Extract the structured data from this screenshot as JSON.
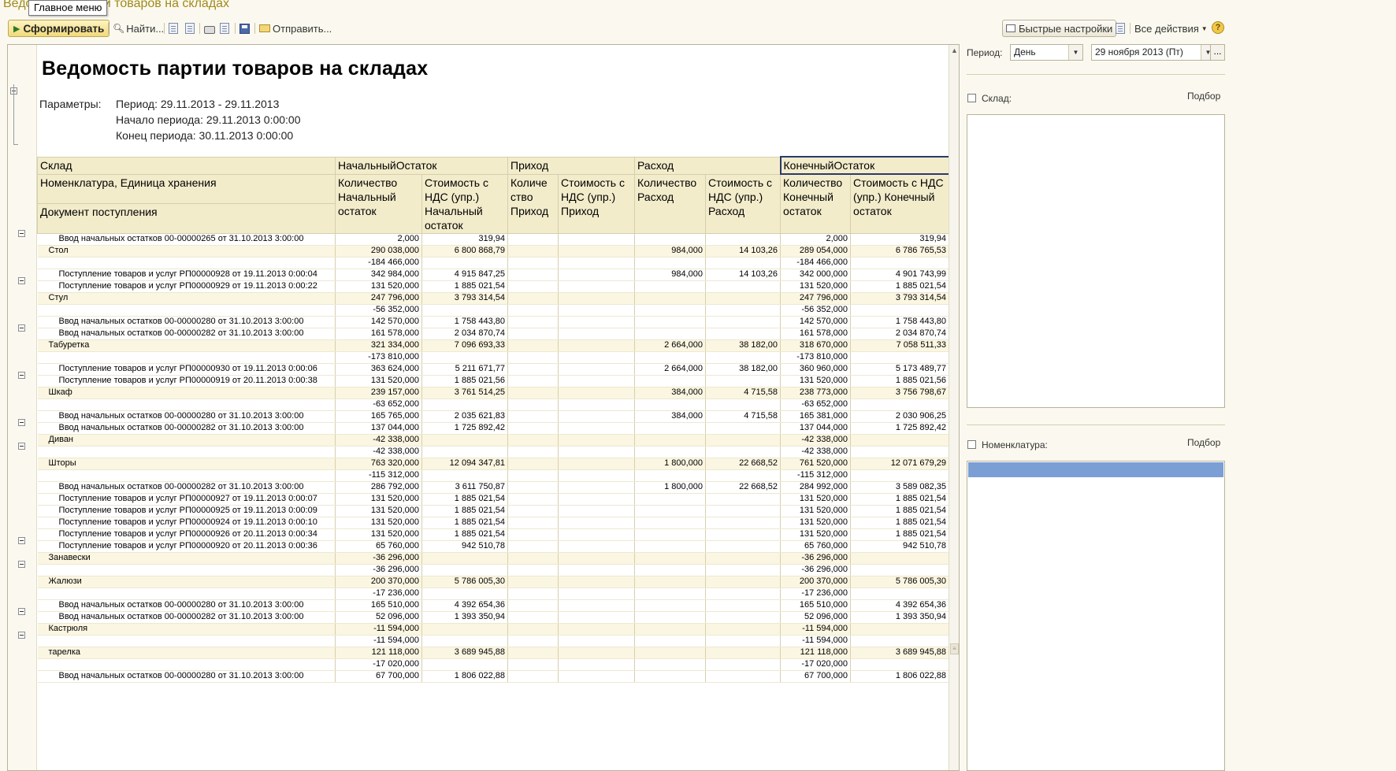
{
  "window": {
    "title": "Ведомость партии товаров на складах",
    "main_menu_tooltip": "Главное меню"
  },
  "toolbar": {
    "generate": "Сформировать",
    "find": "Найти...",
    "send": "Отправить...",
    "quick_settings": "Быстрые настройки",
    "all_actions": "Все действия",
    "help": "?"
  },
  "report": {
    "title": "Ведомость партии товаров на складах",
    "params_label": "Параметры:",
    "params": [
      "Период: 29.11.2013 - 29.11.2013",
      "Начало периода: 29.11.2013 0:00:00",
      "Конец периода: 30.11.2013 0:00:00"
    ],
    "header": {
      "warehouse": "Склад",
      "nomenclature": "Номенклатура, Единица хранения",
      "document": "Документ поступления",
      "start_balance": "НачальныйОстаток",
      "income": "Приход",
      "expense": "Расход",
      "end_balance": "КонечныйОстаток",
      "qty_start": "Количество Начальный остаток",
      "cost_start": "Стоимость с НДС (упр.) Начальный остаток",
      "qty_income": "Количе ство Приход",
      "cost_income": "Стоимость с НДС (упр.) Приход",
      "qty_expense": "Количество Расход",
      "cost_expense": "Стоимость с НДС (упр.) Расход",
      "qty_end": "Количество Конечный остаток",
      "cost_end": "Стоимость с НДС (упр.) Конечный остаток"
    },
    "rows": [
      {
        "t": "d",
        "name": "Ввод начальных остатков 00-00000265 от 31.10.2013 3:00:00",
        "c": [
          "2,000",
          "319,94",
          "",
          "",
          "",
          "",
          "2,000",
          "319,94"
        ]
      },
      {
        "t": "g",
        "name": "Стол",
        "c": [
          "290 038,000",
          "6 800 868,79",
          "",
          "",
          "984,000",
          "14 103,26",
          "289 054,000",
          "6 786 765,53"
        ]
      },
      {
        "t": "d",
        "name": "",
        "c": [
          "-184 466,000",
          "",
          "",
          "",
          "",
          "",
          "-184 466,000",
          ""
        ]
      },
      {
        "t": "d",
        "name": "Поступление товаров и услуг РП00000928 от 19.11.2013 0:00:04",
        "c": [
          "342 984,000",
          "4 915 847,25",
          "",
          "",
          "984,000",
          "14 103,26",
          "342 000,000",
          "4 901 743,99"
        ]
      },
      {
        "t": "d",
        "name": "Поступление товаров и услуг РП00000929 от 19.11.2013 0:00:22",
        "c": [
          "131 520,000",
          "1 885 021,54",
          "",
          "",
          "",
          "",
          "131 520,000",
          "1 885 021,54"
        ]
      },
      {
        "t": "g",
        "name": "Стул",
        "c": [
          "247 796,000",
          "3 793 314,54",
          "",
          "",
          "",
          "",
          "247 796,000",
          "3 793 314,54"
        ]
      },
      {
        "t": "d",
        "name": "",
        "c": [
          "-56 352,000",
          "",
          "",
          "",
          "",
          "",
          "-56 352,000",
          ""
        ]
      },
      {
        "t": "d",
        "name": "Ввод начальных остатков 00-00000280 от 31.10.2013 3:00:00",
        "c": [
          "142 570,000",
          "1 758 443,80",
          "",
          "",
          "",
          "",
          "142 570,000",
          "1 758 443,80"
        ]
      },
      {
        "t": "d",
        "name": "Ввод начальных остатков 00-00000282 от 31.10.2013 3:00:00",
        "c": [
          "161 578,000",
          "2 034 870,74",
          "",
          "",
          "",
          "",
          "161 578,000",
          "2 034 870,74"
        ]
      },
      {
        "t": "g",
        "name": "Табуретка",
        "c": [
          "321 334,000",
          "7 096 693,33",
          "",
          "",
          "2 664,000",
          "38 182,00",
          "318 670,000",
          "7 058 511,33"
        ]
      },
      {
        "t": "d",
        "name": "",
        "c": [
          "-173 810,000",
          "",
          "",
          "",
          "",
          "",
          "-173 810,000",
          ""
        ]
      },
      {
        "t": "d",
        "name": "Поступление товаров и услуг РП00000930 от 19.11.2013 0:00:06",
        "c": [
          "363 624,000",
          "5 211 671,77",
          "",
          "",
          "2 664,000",
          "38 182,00",
          "360 960,000",
          "5 173 489,77"
        ]
      },
      {
        "t": "d",
        "name": "Поступление товаров и услуг РП00000919 от 20.11.2013 0:00:38",
        "c": [
          "131 520,000",
          "1 885 021,56",
          "",
          "",
          "",
          "",
          "131 520,000",
          "1 885 021,56"
        ]
      },
      {
        "t": "g",
        "name": "Шкаф",
        "c": [
          "239 157,000",
          "3 761 514,25",
          "",
          "",
          "384,000",
          "4 715,58",
          "238 773,000",
          "3 756 798,67"
        ]
      },
      {
        "t": "d",
        "name": "",
        "c": [
          "-63 652,000",
          "",
          "",
          "",
          "",
          "",
          "-63 652,000",
          ""
        ]
      },
      {
        "t": "d",
        "name": "Ввод начальных остатков 00-00000280 от 31.10.2013 3:00:00",
        "c": [
          "165 765,000",
          "2 035 621,83",
          "",
          "",
          "384,000",
          "4 715,58",
          "165 381,000",
          "2 030 906,25"
        ]
      },
      {
        "t": "d",
        "name": "Ввод начальных остатков 00-00000282 от 31.10.2013 3:00:00",
        "c": [
          "137 044,000",
          "1 725 892,42",
          "",
          "",
          "",
          "",
          "137 044,000",
          "1 725 892,42"
        ]
      },
      {
        "t": "g",
        "name": "Диван",
        "c": [
          "-42 338,000",
          "",
          "",
          "",
          "",
          "",
          "-42 338,000",
          ""
        ]
      },
      {
        "t": "d",
        "name": "",
        "c": [
          "-42 338,000",
          "",
          "",
          "",
          "",
          "",
          "-42 338,000",
          ""
        ]
      },
      {
        "t": "g",
        "name": "Шторы",
        "c": [
          "763 320,000",
          "12 094 347,81",
          "",
          "",
          "1 800,000",
          "22 668,52",
          "761 520,000",
          "12 071 679,29"
        ]
      },
      {
        "t": "d",
        "name": "",
        "c": [
          "-115 312,000",
          "",
          "",
          "",
          "",
          "",
          "-115 312,000",
          ""
        ]
      },
      {
        "t": "d",
        "name": "Ввод начальных остатков 00-00000282 от 31.10.2013 3:00:00",
        "c": [
          "286 792,000",
          "3 611 750,87",
          "",
          "",
          "1 800,000",
          "22 668,52",
          "284 992,000",
          "3 589 082,35"
        ]
      },
      {
        "t": "d",
        "name": "Поступление товаров и услуг РП00000927 от 19.11.2013 0:00:07",
        "c": [
          "131 520,000",
          "1 885 021,54",
          "",
          "",
          "",
          "",
          "131 520,000",
          "1 885 021,54"
        ]
      },
      {
        "t": "d",
        "name": "Поступление товаров и услуг РП00000925 от 19.11.2013 0:00:09",
        "c": [
          "131 520,000",
          "1 885 021,54",
          "",
          "",
          "",
          "",
          "131 520,000",
          "1 885 021,54"
        ]
      },
      {
        "t": "d",
        "name": "Поступление товаров и услуг РП00000924 от 19.11.2013 0:00:10",
        "c": [
          "131 520,000",
          "1 885 021,54",
          "",
          "",
          "",
          "",
          "131 520,000",
          "1 885 021,54"
        ]
      },
      {
        "t": "d",
        "name": "Поступление товаров и услуг РП00000926 от 20.11.2013 0:00:34",
        "c": [
          "131 520,000",
          "1 885 021,54",
          "",
          "",
          "",
          "",
          "131 520,000",
          "1 885 021,54"
        ]
      },
      {
        "t": "d",
        "name": "Поступление товаров и услуг РП00000920 от 20.11.2013 0:00:36",
        "c": [
          "65 760,000",
          "942 510,78",
          "",
          "",
          "",
          "",
          "65 760,000",
          "942 510,78"
        ]
      },
      {
        "t": "g",
        "name": "Занавески",
        "c": [
          "-36 296,000",
          "",
          "",
          "",
          "",
          "",
          "-36 296,000",
          ""
        ]
      },
      {
        "t": "d",
        "name": "",
        "c": [
          "-36 296,000",
          "",
          "",
          "",
          "",
          "",
          "-36 296,000",
          ""
        ]
      },
      {
        "t": "g",
        "name": "Жалюзи",
        "c": [
          "200 370,000",
          "5 786 005,30",
          "",
          "",
          "",
          "",
          "200 370,000",
          "5 786 005,30"
        ]
      },
      {
        "t": "d",
        "name": "",
        "c": [
          "-17 236,000",
          "",
          "",
          "",
          "",
          "",
          "-17 236,000",
          ""
        ]
      },
      {
        "t": "d",
        "name": "Ввод начальных остатков 00-00000280 от 31.10.2013 3:00:00",
        "c": [
          "165 510,000",
          "4 392 654,36",
          "",
          "",
          "",
          "",
          "165 510,000",
          "4 392 654,36"
        ]
      },
      {
        "t": "d",
        "name": "Ввод начальных остатков 00-00000282 от 31.10.2013 3:00:00",
        "c": [
          "52 096,000",
          "1 393 350,94",
          "",
          "",
          "",
          "",
          "52 096,000",
          "1 393 350,94"
        ]
      },
      {
        "t": "g",
        "name": "Кастрюля",
        "c": [
          "-11 594,000",
          "",
          "",
          "",
          "",
          "",
          "-11 594,000",
          ""
        ]
      },
      {
        "t": "d",
        "name": "",
        "c": [
          "-11 594,000",
          "",
          "",
          "",
          "",
          "",
          "-11 594,000",
          ""
        ]
      },
      {
        "t": "g",
        "name": "тарелка",
        "c": [
          "121 118,000",
          "3 689 945,88",
          "",
          "",
          "",
          "",
          "121 118,000",
          "3 689 945,88"
        ]
      },
      {
        "t": "d",
        "name": "",
        "c": [
          "-17 020,000",
          "",
          "",
          "",
          "",
          "",
          "-17 020,000",
          ""
        ]
      },
      {
        "t": "d",
        "name": "Ввод начальных остатков 00-00000280 от 31.10.2013 3:00:00",
        "c": [
          "67 700,000",
          "1 806 022,88",
          "",
          "",
          "",
          "",
          "67 700,000",
          "1 806 022,88"
        ]
      }
    ]
  },
  "panel": {
    "period_label": "Период:",
    "period_value": "День",
    "date_value": "29 ноября 2013 (Пт)",
    "dots": "...",
    "warehouse_label": "Склад:",
    "warehouse_pick": "Подбор",
    "nomenclature_label": "Номенклатура:",
    "nomenclature_pick": "Подбор"
  }
}
